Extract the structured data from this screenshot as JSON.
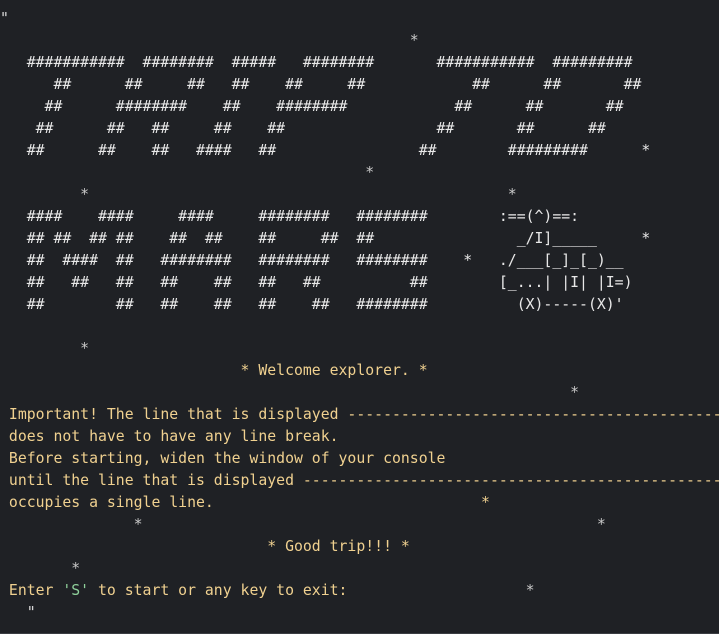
{
  "terminal": {
    "lines": [
      {
        "cls": "quote",
        "text": "\""
      },
      {
        "cls": "gray",
        "text": "                                              *"
      },
      {
        "cls": "art",
        "text": "   ###########  ########  #####   ########       ###########  #########"
      },
      {
        "cls": "art",
        "text": "      ##      ##     ##   ##    ##     ##            ##      ##       ##"
      },
      {
        "cls": "art",
        "text": "     ##      ########    ##    ########            ##      ##       ##"
      },
      {
        "cls": "art",
        "text": "    ##      ##   ##     ##    ##                 ##       ##      ##"
      },
      {
        "cls": "art",
        "text": "   ##      ##    ##   ####   ##                ##        #########      *"
      },
      {
        "cls": "gray",
        "text": "                                         *"
      },
      {
        "cls": "gray",
        "text": "         *                                               *"
      },
      {
        "cls": "art",
        "text": "   ####    ####     ####     ########   ########        :==(^)==:"
      },
      {
        "cls": "art",
        "text": "   ## ##  ## ##    ##  ##    ##     ##  ##                _/I]_____     *"
      },
      {
        "cls": "art",
        "text": "   ##  ####  ##   ########   ########   ########    *   ./___[_]_[_)__"
      },
      {
        "cls": "art",
        "text": "   ##   ##   ##   ##    ##   ##   ##          ##        [_...| |I| |I=)"
      },
      {
        "cls": "art",
        "text": "   ##        ##   ##    ##   ##    ##   ########          (X)-----(X)'"
      },
      {
        "cls": "gray",
        "text": ""
      },
      {
        "cls": "gray",
        "text": "         *"
      },
      {
        "cls": "msg",
        "text": "                           * Welcome explorer. *"
      },
      {
        "cls": "gray",
        "text": "                                                                *"
      },
      {
        "cls": "msg",
        "text": " Important! The line that is displayed --------------------------------------------"
      },
      {
        "cls": "msg",
        "text": " does not have to have any line break."
      },
      {
        "cls": "msg",
        "text": " Before starting, widen the window of your console"
      },
      {
        "cls": "msg",
        "text": " until the line that is displayed -------------------------------------------------"
      },
      {
        "cls": "msg",
        "text": " occupies a single line.                              *"
      },
      {
        "cls": "gray",
        "text": "               *                                                   *"
      },
      {
        "cls": "msg",
        "text": "                              * Good trip!!! *"
      },
      {
        "cls": "gray",
        "text": "        *"
      }
    ],
    "prompt": {
      "before": " Enter ",
      "key": "'S'",
      "after": " to start or any key to exit:",
      "trailing_star": "                    *"
    },
    "last_line": "   \""
  }
}
